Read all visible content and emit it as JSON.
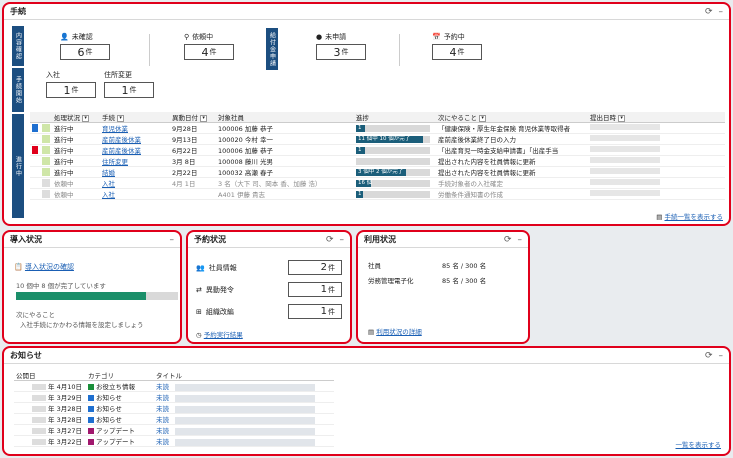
{
  "procedures": {
    "title": "手続",
    "side_labels": [
      "内容確認",
      "手続開始",
      "進行中"
    ],
    "pay_label": "給付金申請",
    "stats": {
      "unconfirmed": {
        "label": "未確認",
        "value": "6",
        "unit": "件"
      },
      "requesting": {
        "label": "依頼中",
        "value": "4",
        "unit": "件"
      },
      "not_applied": {
        "label": "未申請",
        "value": "3",
        "unit": "件"
      },
      "reserved": {
        "label": "予約中",
        "value": "4",
        "unit": "件"
      },
      "hire": {
        "label": "入社",
        "value": "1",
        "unit": "件"
      },
      "address": {
        "label": "住所変更",
        "value": "1",
        "unit": "件"
      }
    },
    "columns": [
      "処理状況",
      "手続",
      "異動日付",
      "対象社員",
      "進捗",
      "次にやること",
      "提出日時"
    ],
    "rows": [
      {
        "mark": "#1e6fd0",
        "status": "進行中",
        "proc": "育児休業",
        "date": "9月28日",
        "emp": "100006",
        "name": "加藤 恭子",
        "progress_text": "1",
        "progress": 0.12,
        "next": "「健康保険・厚生年金保険 育児休業等取得者",
        "gray": false
      },
      {
        "mark": "",
        "status": "進行中",
        "proc": "産前産後休業",
        "date": "9月13日",
        "emp": "100020",
        "name": "今村 幸一",
        "progress_text": "11 個中 10 個が完了",
        "progress": 0.91,
        "next": "産前産後休業終了日の入力",
        "gray": false
      },
      {
        "mark": "#e0001b",
        "status": "進行中",
        "proc": "産前産後休業",
        "date": "6月22日",
        "emp": "100006",
        "name": "加藤 恭子",
        "progress_text": "1",
        "progress": 0.12,
        "next": "「出産育児一時金支給申請書」「出産手当",
        "gray": false
      },
      {
        "mark": "",
        "status": "進行中",
        "proc": "住所変更",
        "date": "3月 8日",
        "emp": "100008",
        "name": "藤川 光男",
        "progress_text": "",
        "progress": 0.0,
        "next": "提出された内容を社員情報に更新",
        "gray": false
      },
      {
        "mark": "",
        "status": "進行中",
        "proc": "結婚",
        "date": "2月22日",
        "emp": "100032",
        "name": "高瀬 春子",
        "progress_text": "3 個中 2 個が完了",
        "progress": 0.67,
        "next": "提出された内容を社員情報に更新",
        "gray": false
      },
      {
        "mark": "",
        "status": "依頼中",
        "proc": "入社",
        "date": "4月 1日",
        "emp": "3 名（大下 司、岡本 香、加藤 浩）",
        "name": "",
        "progress_text": "16 個",
        "progress": 0.2,
        "next": "手続対象者の入社確定",
        "gray": true
      },
      {
        "mark": "",
        "status": "依頼中",
        "proc": "入社",
        "date": "",
        "emp": "A401",
        "name": "伊藤 貴志",
        "progress_text": "1",
        "progress": 0.1,
        "next": "労働条件通知書の作成",
        "gray": true
      }
    ],
    "show_list": "手続一覧を表示する"
  },
  "intro": {
    "title": "導入状況",
    "link": "導入状況の確認",
    "progress_text": "10 個中 8 個が完了しています",
    "progress": 0.8,
    "next_title": "次にやること",
    "next_text": "入社手続にかかわる情報を設定しましょう"
  },
  "reserve": {
    "title": "予約状況",
    "items": [
      {
        "label": "社員情報",
        "value": "2",
        "unit": "件"
      },
      {
        "label": "異動発令",
        "value": "1",
        "unit": "件"
      },
      {
        "label": "組織改編",
        "value": "1",
        "unit": "件"
      }
    ],
    "link": "予約実行結果"
  },
  "usage": {
    "title": "利用状況",
    "rows": [
      {
        "label": "社員",
        "value": "85 名 / 300 名"
      },
      {
        "label": "労務管理電子化",
        "value": "85 名 / 300 名"
      }
    ],
    "link": "利用状況の詳細"
  },
  "news": {
    "title": "お知らせ",
    "columns": [
      "公開日",
      "カテゴリ",
      "タイトル"
    ],
    "rows": [
      {
        "date": "年 4月10日",
        "color": "#1a8f3a",
        "cat": "お役立ち情報",
        "status": "未読"
      },
      {
        "date": "年 3月29日",
        "color": "#1e6fd0",
        "cat": "お知らせ",
        "status": "未読"
      },
      {
        "date": "年 3月28日",
        "color": "#1e6fd0",
        "cat": "お知らせ",
        "status": "未読"
      },
      {
        "date": "年 3月28日",
        "color": "#1e6fd0",
        "cat": "お知らせ",
        "status": "未読"
      },
      {
        "date": "年 3月27日",
        "color": "#a0176d",
        "cat": "アップデート",
        "status": "未読"
      },
      {
        "date": "年 3月22日",
        "color": "#a0176d",
        "cat": "アップデート",
        "status": "未読"
      }
    ],
    "show_list": "一覧を表示する"
  }
}
